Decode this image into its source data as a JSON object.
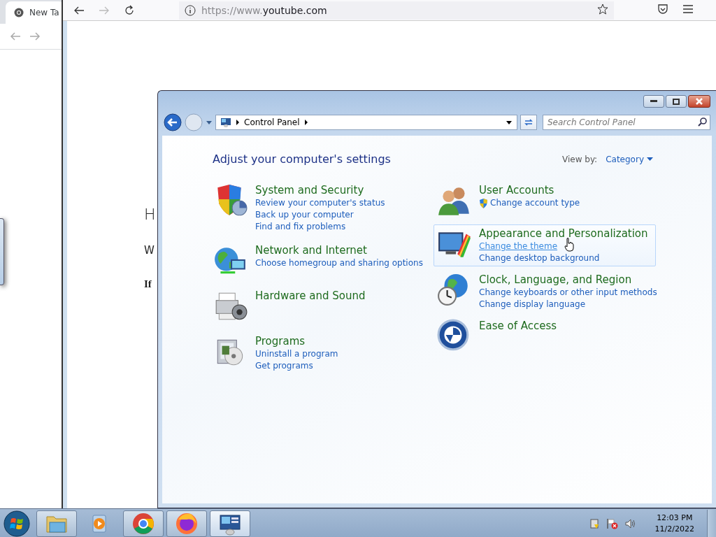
{
  "chrome_window": {
    "tab": {
      "title": "New Ta"
    }
  },
  "firefox_window": {
    "url_prefix": "https://www.",
    "url_domain": "youtube.com",
    "page_text": [
      "H",
      "W",
      "If"
    ]
  },
  "control_panel": {
    "breadcrumb": "Control Panel",
    "search": {
      "placeholder": "Search Control Panel"
    },
    "heading": "Adjust your computer's settings",
    "view_by_label": "View by:",
    "view_by_value": "Category",
    "left_categories": [
      {
        "title": "System and Security",
        "hovered": false,
        "links": [
          {
            "text": "Review your computer's status",
            "shield": false,
            "hovered": false
          },
          {
            "text": "Back up your computer",
            "shield": false,
            "hovered": false
          },
          {
            "text": "Find and fix problems",
            "shield": false,
            "hovered": false
          }
        ]
      },
      {
        "title": "Network and Internet",
        "hovered": false,
        "links": [
          {
            "text": "Choose homegroup and sharing options",
            "shield": false,
            "hovered": false
          }
        ]
      },
      {
        "title": "Hardware and Sound",
        "hovered": false
      },
      {
        "title": "Programs",
        "hovered": false,
        "links": [
          {
            "text": "Uninstall a program",
            "shield": false,
            "hovered": false
          },
          {
            "text": "Get programs",
            "shield": false,
            "hovered": false
          }
        ]
      }
    ],
    "right_categories": [
      {
        "title": "User Accounts",
        "hovered": false,
        "links": [
          {
            "text": "Change account type",
            "shield": true,
            "hovered": false
          }
        ]
      },
      {
        "title": "Appearance and Personalization",
        "hovered": true,
        "links": [
          {
            "text": "Change the theme",
            "shield": false,
            "hovered": true
          },
          {
            "text": "Change desktop background",
            "shield": false,
            "hovered": false
          }
        ]
      },
      {
        "title": "Clock, Language, and Region",
        "hovered": false,
        "links": [
          {
            "text": "Change keyboards or other input methods",
            "shield": false,
            "hovered": false
          },
          {
            "text": "Change display language",
            "shield": false,
            "hovered": false
          }
        ]
      },
      {
        "title": "Ease of Access",
        "hovered": false
      }
    ]
  },
  "taskbar": {
    "apps": [
      {
        "running": true,
        "active": false
      },
      {
        "running": false,
        "active": false
      },
      {
        "running": true,
        "active": false
      },
      {
        "running": true,
        "active": false
      },
      {
        "running": true,
        "active": true
      }
    ],
    "time": "12:03 PM",
    "date": "11/2/2022"
  }
}
